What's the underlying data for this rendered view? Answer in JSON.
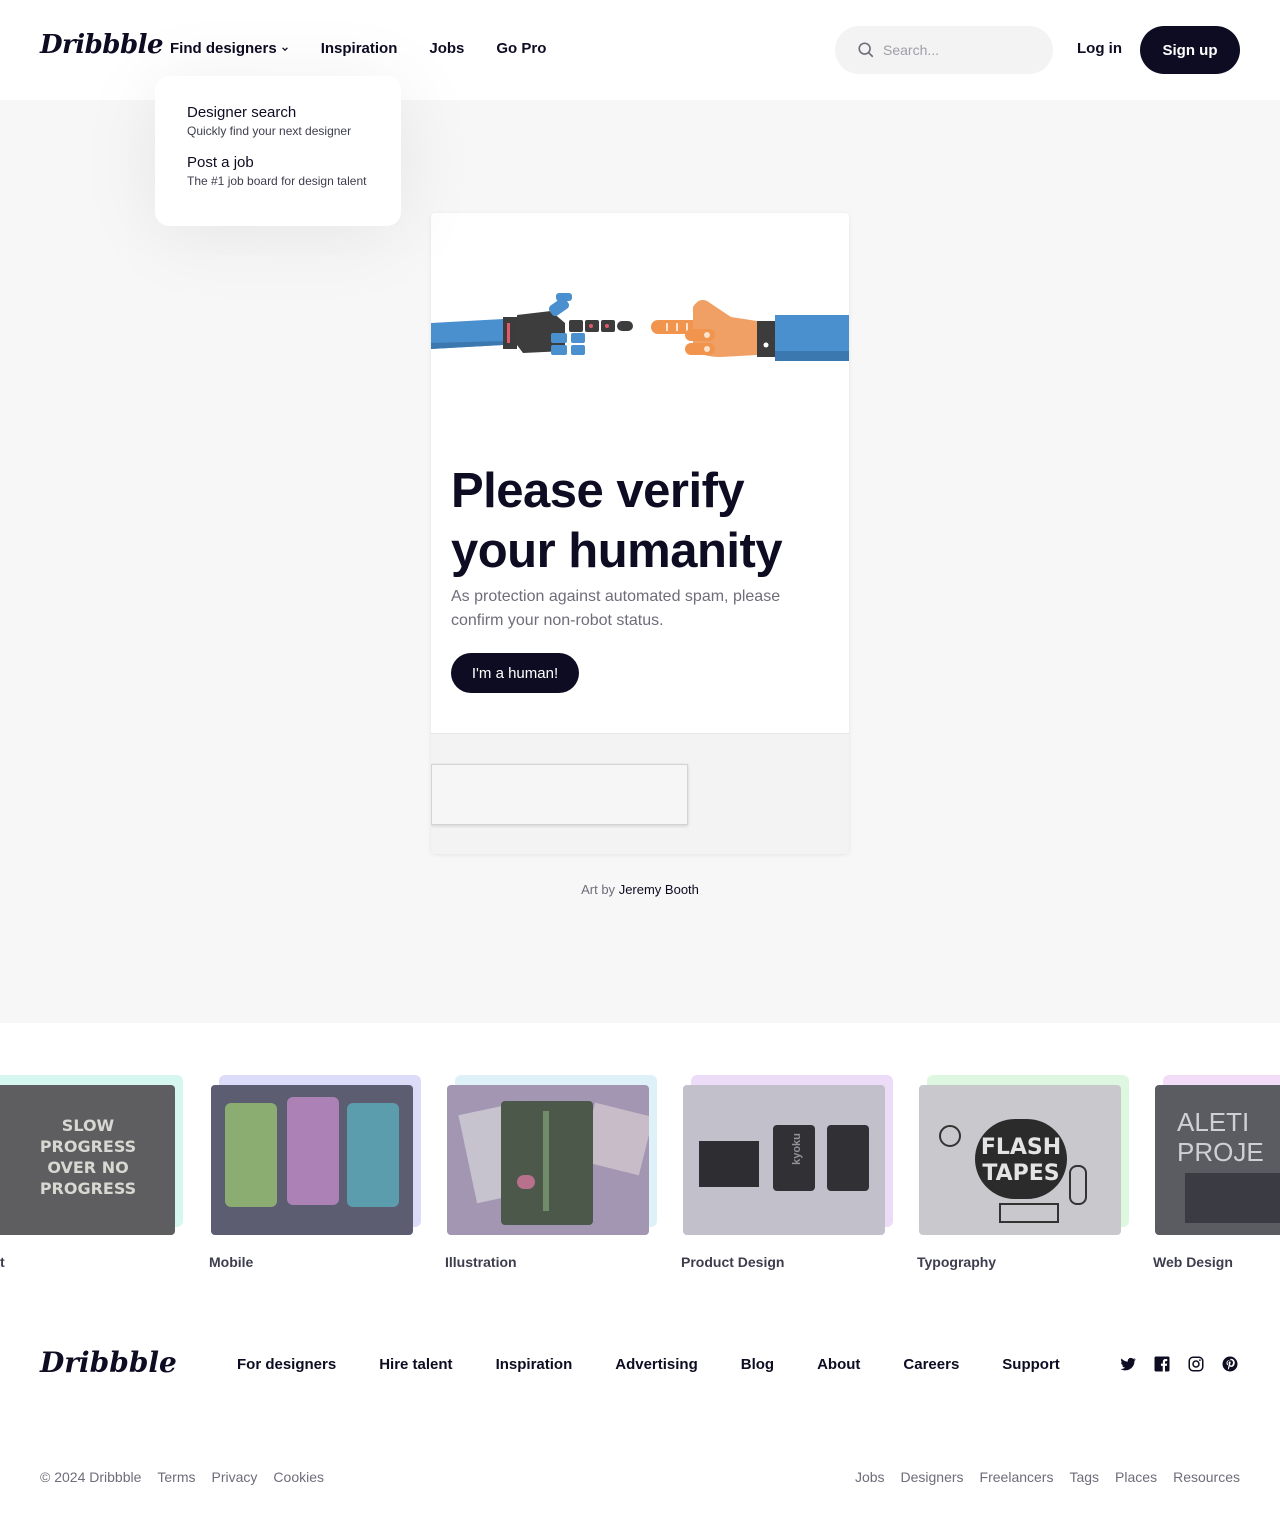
{
  "header": {
    "logo": "Dribbble",
    "nav": {
      "find_designers": "Find designers",
      "inspiration": "Inspiration",
      "jobs": "Jobs",
      "go_pro": "Go Pro"
    },
    "search_placeholder": "Search...",
    "login": "Log in",
    "signup": "Sign up"
  },
  "dropdown": {
    "items": [
      {
        "title": "Designer search",
        "subtitle": "Quickly find your next designer"
      },
      {
        "title": "Post a job",
        "subtitle": "The #1 job board for design talent"
      }
    ]
  },
  "verify": {
    "title": "Please verify your humanity",
    "description": "As protection against automated spam, please confirm your non-robot status.",
    "button": "I'm a human!",
    "art_by_prefix": "Art by",
    "art_by_name": "Jeremy Booth"
  },
  "categories": [
    {
      "label": "t",
      "thumb_text": "SLOW PROGRESS OVER NO PROGRESS",
      "accent": "#bff0e6"
    },
    {
      "label": "Mobile",
      "thumb_text": "",
      "accent": "#c9c7f5"
    },
    {
      "label": "Illustration",
      "thumb_text": "",
      "accent": "#c9e9f5"
    },
    {
      "label": "Product Design",
      "thumb_text": "kyoku",
      "accent": "#e4c9f5"
    },
    {
      "label": "Typography",
      "thumb_text": "FLASH TAPES",
      "accent": "#c9f5cf"
    },
    {
      "label": "Web Design",
      "thumb_text": "ALETI PROJE",
      "accent": "#f0c9f5"
    }
  ],
  "footer": {
    "logo": "Dribbble",
    "nav": [
      "For designers",
      "Hire talent",
      "Inspiration",
      "Advertising",
      "Blog",
      "About",
      "Careers",
      "Support"
    ],
    "social_icons": [
      "twitter-icon",
      "facebook-icon",
      "instagram-icon",
      "pinterest-icon"
    ],
    "copyright": "© 2024 Dribbble",
    "legal": [
      "Terms",
      "Privacy",
      "Cookies"
    ],
    "bottom_links": [
      "Jobs",
      "Designers",
      "Freelancers",
      "Tags",
      "Places",
      "Resources"
    ]
  },
  "colors": {
    "brand_dark": "#0d0c22",
    "muted": "#6e6d7a",
    "robot_blue": "#4a90cf",
    "human_orange": "#f0944e"
  }
}
